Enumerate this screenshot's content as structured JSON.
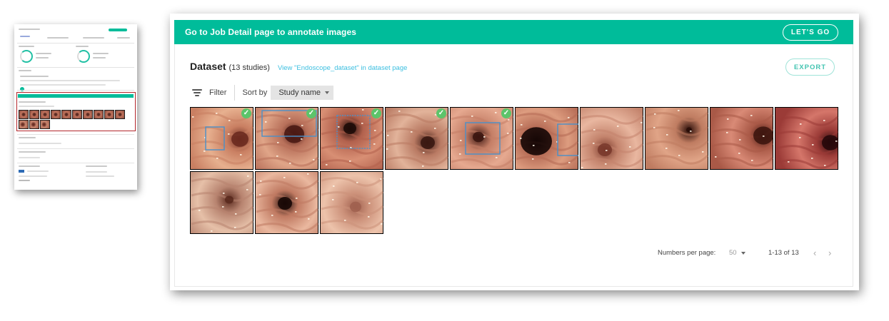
{
  "banner": {
    "text": "Go to Job Detail page to annotate images",
    "button_label": "LET'S GO",
    "color": "#00bc9a"
  },
  "dataset": {
    "title": "Dataset",
    "count": "(13 studies)",
    "link": "View \"Endoscope_dataset\" in dataset page",
    "export_label": "EXPORT"
  },
  "toolbar": {
    "filter_label": "Filter",
    "sort_label": "Sort by",
    "sort_value": "Study name"
  },
  "images": [
    {
      "checked": true,
      "annotated": true
    },
    {
      "checked": true,
      "annotated": true
    },
    {
      "checked": true,
      "annotated": true
    },
    {
      "checked": true,
      "annotated": false
    },
    {
      "checked": true,
      "annotated": true
    },
    {
      "checked": false,
      "annotated": true
    },
    {
      "checked": false,
      "annotated": false
    },
    {
      "checked": false,
      "annotated": false
    },
    {
      "checked": false,
      "annotated": false
    },
    {
      "checked": false,
      "annotated": false
    },
    {
      "checked": false,
      "annotated": false
    },
    {
      "checked": false,
      "annotated": false
    },
    {
      "checked": false,
      "annotated": false
    }
  ],
  "pagination": {
    "per_page_label": "Numbers per page:",
    "per_page_value": "50",
    "range": "1-13 of 13",
    "prev_icon": "chevron-left-icon",
    "next_icon": "chevron-right-icon"
  },
  "icons": {
    "filter": "filter-lines-icon",
    "check": "check-circle-icon"
  },
  "colors": {
    "accent": "#00bc9a",
    "link": "#3cbfe0",
    "check": "#5cc46a",
    "annotation_box": "#4a90c8",
    "highlight_frame": "#b3262b"
  }
}
